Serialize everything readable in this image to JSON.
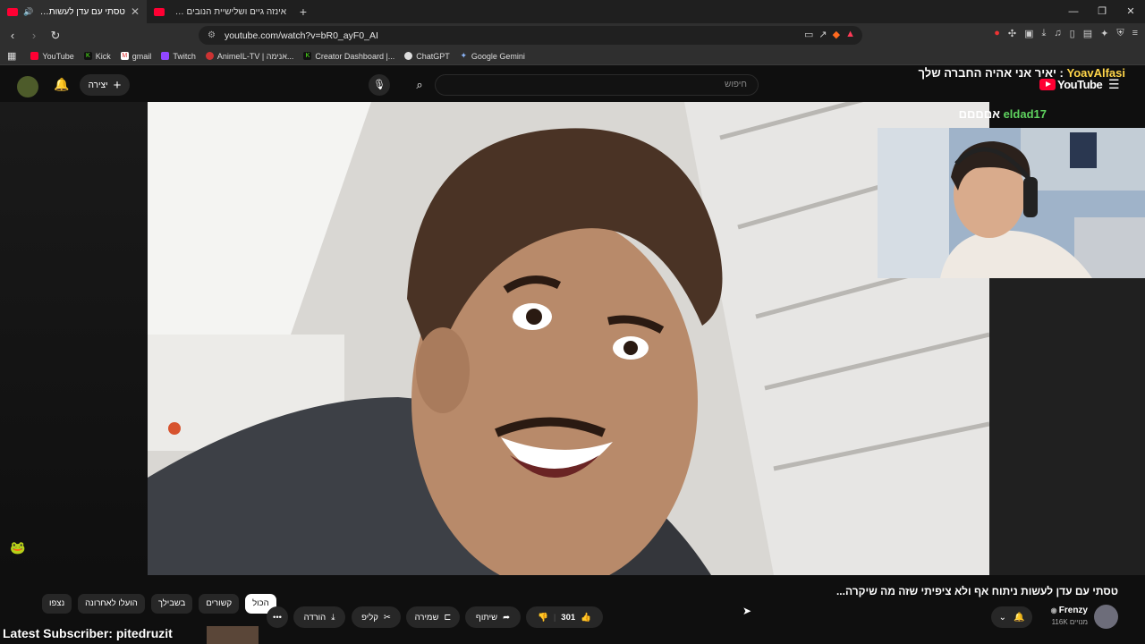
{
  "browser": {
    "tabs": [
      {
        "title": "טסתי עם עדן לעשות ניתוח אף",
        "active": true
      },
      {
        "title": "אינזה גיים ושלישיית הנובים איבדו את",
        "active": false
      }
    ],
    "url": "youtube.com/watch?v=bR0_ayF0_AI",
    "bookmarks": [
      "YouTube",
      "Kick",
      "gmail",
      "Twitch",
      "AnimeIL-TV | אנימה...",
      "Creator Dashboard |...",
      "ChatGPT",
      "Google Gemini"
    ]
  },
  "youtube": {
    "create_label": "יצירה",
    "search_placeholder": "חיפוש",
    "logo_text": "YouTube"
  },
  "overlay": {
    "chat": [
      {
        "name": "YoavAlfasi",
        "message": "יאיר אני אהיה החברה שלך"
      },
      {
        "name": "eldad17",
        "message": "אםםםם"
      }
    ],
    "latest_subscriber": "Latest Subscriber: pitedruzit"
  },
  "video": {
    "title": "טסתי עם עדן לעשות ניתוח אף ולא ציפיתי שזה מה שיקרה...",
    "like_count": "301",
    "share_label": "שיתוף",
    "save_label": "שמירה",
    "clip_label": "קליפ",
    "download_label": "הורדה",
    "channel_name": "Frenzy",
    "subscribers": "116K מנויים"
  },
  "chips": [
    "הכול",
    "קשורים",
    "בשבילך",
    "הועלו לאחרונה",
    "נצפו"
  ],
  "colors": {
    "accent": "#ff0033",
    "chat_name_1": "#ffd54a",
    "chat_name_2": "#5fd35f"
  }
}
